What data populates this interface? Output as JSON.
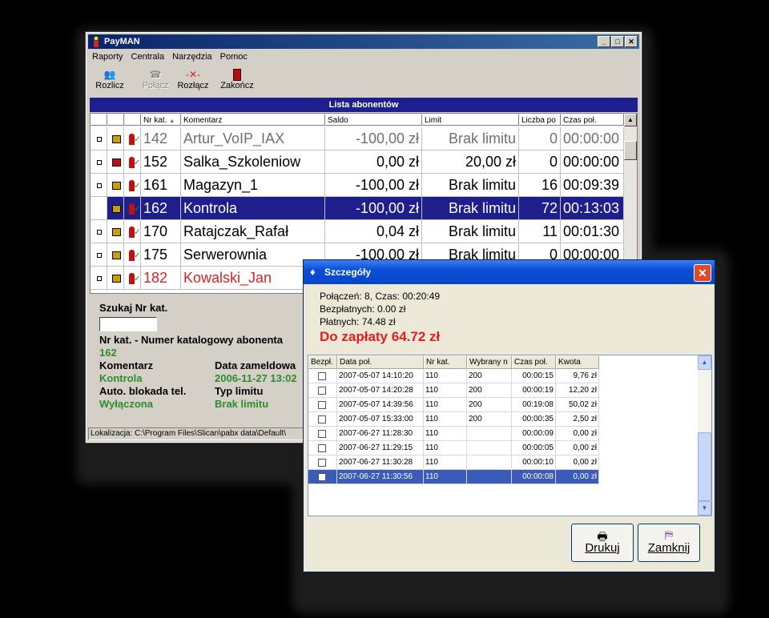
{
  "main_window": {
    "title": "PayMAN",
    "menu": [
      "Raporty",
      "Centrala",
      "Narzędzia",
      "Pomoc"
    ],
    "toolbar": [
      {
        "label": "Rozlicz",
        "icon": "people-icon",
        "enabled": true
      },
      {
        "label": "Połącz",
        "icon": "phone-icon",
        "enabled": false
      },
      {
        "label": "Rozłącz",
        "icon": "disconnect-icon",
        "enabled": true
      },
      {
        "label": "Zakończ",
        "icon": "exit-icon",
        "enabled": true
      }
    ],
    "list_title": "Lista abonentów",
    "columns": [
      "",
      "",
      "",
      "Nr kat.",
      "Komentarz",
      "Saldo",
      "Limit",
      "Liczba po",
      "Czas poł."
    ],
    "rows": [
      {
        "nr": "142",
        "komentarz": "Artur_VoIP_IAX",
        "saldo": "-100,00 zł",
        "limit": "Brak limitu",
        "liczba": "0",
        "czas": "00:00:00",
        "style": "grey"
      },
      {
        "nr": "152",
        "komentarz": "Salka_Szkoleniow",
        "saldo": "0,00 zł",
        "limit": "20,00 zł",
        "liczba": "0",
        "czas": "00:00:00",
        "style": "normal"
      },
      {
        "nr": "161",
        "komentarz": "Magazyn_1",
        "saldo": "-100,00 zł",
        "limit": "Brak limitu",
        "liczba": "16",
        "czas": "00:09:39",
        "style": "normal"
      },
      {
        "nr": "162",
        "komentarz": "Kontrola",
        "saldo": "-100,00 zł",
        "limit": "Brak limitu",
        "liczba": "72",
        "czas": "00:13:03",
        "style": "selected"
      },
      {
        "nr": "170",
        "komentarz": "Ratajczak_Rafał",
        "saldo": "0,04 zł",
        "limit": "Brak limitu",
        "liczba": "11",
        "czas": "00:01:30",
        "style": "normal"
      },
      {
        "nr": "175",
        "komentarz": "Serwerownia",
        "saldo": "-100,00 zł",
        "limit": "Brak limitu",
        "liczba": "0",
        "czas": "00:00:00",
        "style": "normal"
      },
      {
        "nr": "182",
        "komentarz": "Kowalski_Jan",
        "saldo": "",
        "limit": "",
        "liczba": "",
        "czas": "",
        "style": "red"
      }
    ],
    "details": {
      "search_label": "Szukaj Nr kat.",
      "nr_label": "Nr kat. - Numer katalogowy abonenta",
      "nr_value": "162",
      "komentarz_label": "Komentarz",
      "komentarz_value": "Kontrola",
      "data_label": "Data zameldowa",
      "data_value": "2006-11-27 13:02",
      "blokada_label": "Auto. blokada tel.",
      "blokada_value": "Wyłączona",
      "typ_label": "Typ limitu",
      "typ_value": "Brak limitu"
    },
    "status": "Lokalizacja: C:\\Program Files\\Slican\\pabx data\\Default\\"
  },
  "dialog": {
    "title": "Szczegóły",
    "polaczen": "Połączeń: 8, Czas: 00:20:49",
    "bezplatnych": "Bezpłatnych: 0.00 zł",
    "platnych": "Płatnych: 74.48 zł",
    "do_zaplaty": "Do zapłaty 64.72 zł",
    "columns": [
      "Bezpł.",
      "Data poł.",
      "Nr kat.",
      "Wybrany n",
      "Czas poł.",
      "Kwota"
    ],
    "rows": [
      {
        "data": "2007-05-07 14:10:20",
        "nr": "110",
        "wybrany": "200",
        "czas": "00:00:15",
        "kwota": "9,76 zł"
      },
      {
        "data": "2007-05-07 14:20:28",
        "nr": "110",
        "wybrany": "200",
        "czas": "00:00:19",
        "kwota": "12,20 zł"
      },
      {
        "data": "2007-05-07 14:39:56",
        "nr": "110",
        "wybrany": "200",
        "czas": "00:19:08",
        "kwota": "50,02 zł"
      },
      {
        "data": "2007-05-07 15:33:00",
        "nr": "110",
        "wybrany": "200",
        "czas": "00:00:35",
        "kwota": "2,50 zł"
      },
      {
        "data": "2007-06-27 11:28:30",
        "nr": "110",
        "wybrany": "",
        "czas": "00:00:09",
        "kwota": "0,00 zł"
      },
      {
        "data": "2007-06-27 11:29:15",
        "nr": "110",
        "wybrany": "",
        "czas": "00:00:05",
        "kwota": "0,00 zł"
      },
      {
        "data": "2007-06-27 11:30:28",
        "nr": "110",
        "wybrany": "",
        "czas": "00:00:10",
        "kwota": "0,00 zł"
      },
      {
        "data": "2007-06-27 11:30:56",
        "nr": "110",
        "wybrany": "",
        "czas": "00:00:08",
        "kwota": "0,00 zł"
      }
    ],
    "selected_row": 7,
    "buttons": {
      "print": "Drukuj",
      "close": "Zamknij"
    }
  }
}
